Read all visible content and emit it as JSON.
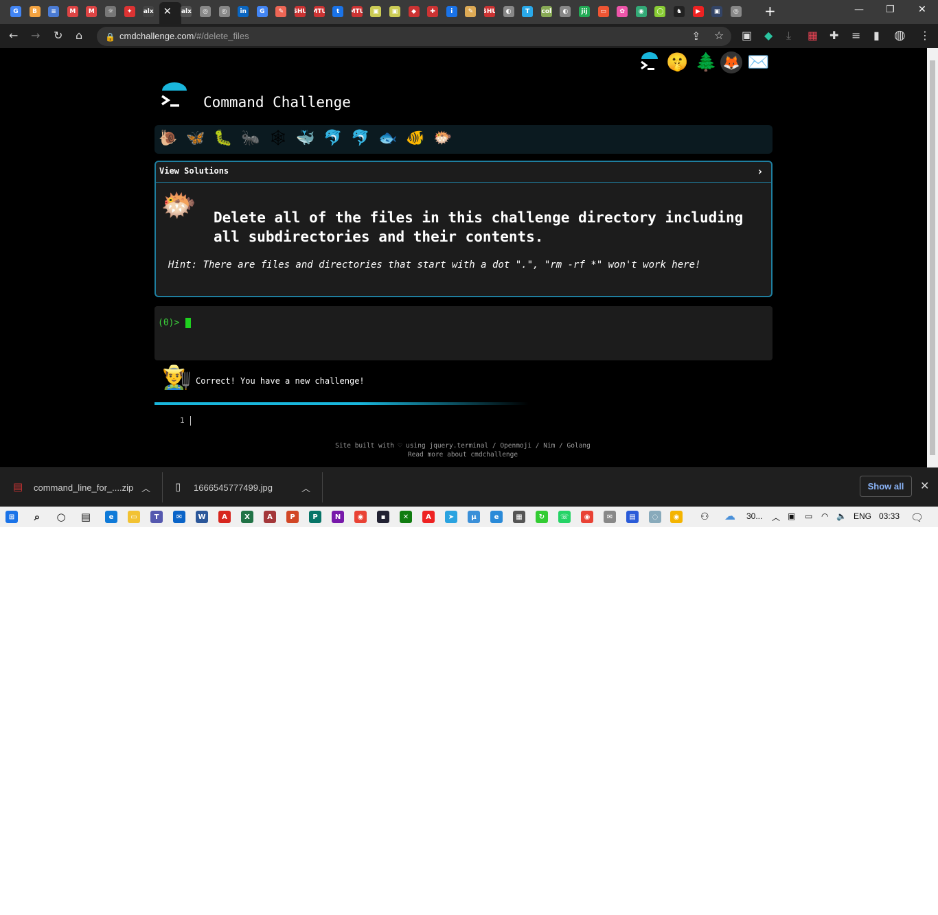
{
  "browser": {
    "url_host": "cmdchallenge.com",
    "url_path": "/#/delete_files",
    "tab_favicons": [
      "G",
      "B",
      "≡",
      "M",
      "M",
      "☼",
      "✦",
      "alx",
      "✕",
      "alx",
      "◎",
      "◎",
      "in",
      "G",
      "✎",
      "SHU",
      "MTU",
      "t",
      "MTU",
      "▣",
      "▣",
      "◆",
      "✚",
      "i",
      "✎",
      "SHU",
      "◐",
      "T",
      "colorlib",
      "◐",
      "jiji",
      "▭",
      "✿",
      "◉",
      "◯",
      "♞",
      "▶",
      "▣",
      "◎"
    ],
    "window_controls": {
      "minimize": "—",
      "restore": "❐",
      "close": "✕"
    },
    "new_tab": "+"
  },
  "page": {
    "title": "Command Challenge",
    "view_solutions": "View Solutions",
    "task": "Delete all of the files in this challenge directory including all subdirectories and their contents.",
    "hint": "Hint: There are files and directories that start with a dot \".\", \"rm -rf *\" won't work here!",
    "prompt": "(0)>",
    "correct_message": "Correct! You have a new challenge!",
    "line_number": "1",
    "footer_line1": "Site built with ♡ using jquery.terminal / Openmoji / Nim / Golang",
    "footer_line2": "Read more about cmdchallenge",
    "top_icons": [
      "terminal-logo",
      "shushing-face",
      "evergreen-tree",
      "gitlab-fox",
      "envelope"
    ],
    "levels": [
      "🐌",
      "🦋",
      "🐛",
      "🐜",
      "🕸",
      "🐳",
      "🐬",
      "🐬",
      "🐟",
      "🐠",
      "🐡"
    ]
  },
  "downloads": {
    "items": [
      {
        "name": "command_line_for_....zip"
      },
      {
        "name": "1666545777499.jpg"
      }
    ],
    "show_all": "Show all"
  },
  "taskbar": {
    "weather": "30...",
    "language": "ENG",
    "time": "03:33"
  },
  "colors": {
    "accent": "#19b6dc",
    "prompt_green": "#3bd13b",
    "border": "#1f7fa0"
  }
}
